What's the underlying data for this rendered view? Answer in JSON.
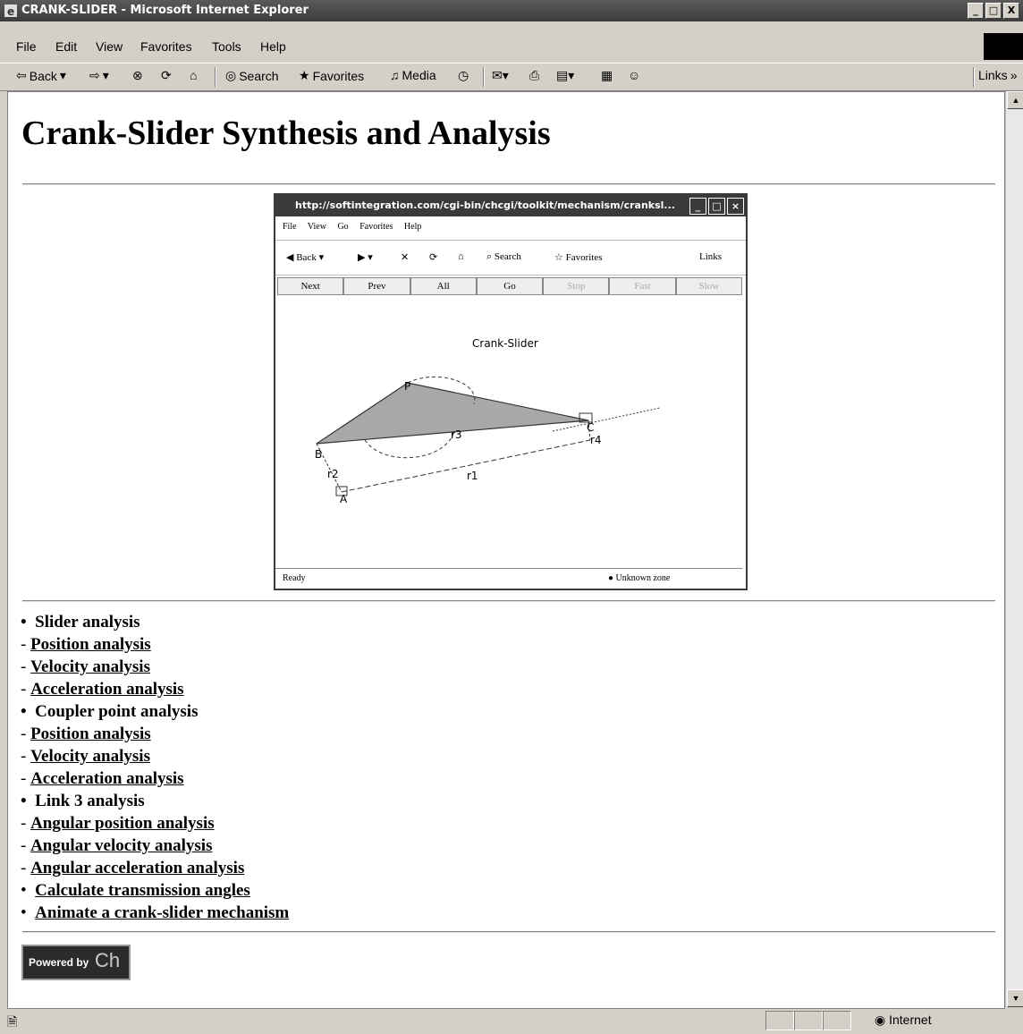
{
  "window": {
    "title": "CRANK-SLIDER - Microsoft Internet Explorer",
    "buttons": [
      "_",
      "□",
      "X"
    ]
  },
  "menubar": {
    "items": [
      "File",
      "Edit",
      "View",
      "Favorites",
      "Tools",
      "Help"
    ]
  },
  "toolbar": {
    "back": "Back",
    "search": "Search",
    "favorites": "Favorites",
    "media": "Media",
    "links": "Links"
  },
  "page": {
    "heading": "Crank-Slider Synthesis and Analysis",
    "screenshot": {
      "title": "http://softintegration.com/cgi-bin/chcgi/toolkit/mechanism/cranksl...",
      "menu": [
        "File",
        "View",
        "Go",
        "Favorites",
        "Help"
      ],
      "toolbar": {
        "back": "Back",
        "search": "Search",
        "favorites": "Favorites",
        "links": "Links"
      },
      "nav": [
        "Next",
        "Prev",
        "All",
        "Go",
        "Stop",
        "Fast",
        "Slow"
      ],
      "chart_title": "Crank-Slider",
      "labels": {
        "P": "P",
        "B": "B",
        "C": "C",
        "A": "A",
        "r1": "r1",
        "r2": "r2",
        "r3": "r3",
        "r4": "r4"
      },
      "status_left": "Ready",
      "status_right": "Unknown zone"
    },
    "sections": [
      {
        "type": "head",
        "text": "Slider analysis"
      },
      {
        "type": "link",
        "text": "Position analysis"
      },
      {
        "type": "link",
        "text": "Velocity analysis"
      },
      {
        "type": "link",
        "text": "Acceleration analysis"
      },
      {
        "type": "head",
        "text": "Coupler point analysis"
      },
      {
        "type": "link",
        "text": "Position analysis"
      },
      {
        "type": "link",
        "text": "Velocity analysis"
      },
      {
        "type": "link",
        "text": "Acceleration analysis"
      },
      {
        "type": "head",
        "text": "Link 3 analysis"
      },
      {
        "type": "link",
        "text": "Angular position analysis"
      },
      {
        "type": "link",
        "text": "Angular velocity analysis"
      },
      {
        "type": "link",
        "text": "Angular acceleration analysis"
      },
      {
        "type": "bullet-link",
        "text": "Calculate transmission angles"
      },
      {
        "type": "bullet-link",
        "text": "Animate a crank-slider mechanism"
      }
    ],
    "powered_by": {
      "text": "Powered by",
      "brand": "Ch"
    }
  },
  "statusbar": {
    "zone": "Internet"
  }
}
